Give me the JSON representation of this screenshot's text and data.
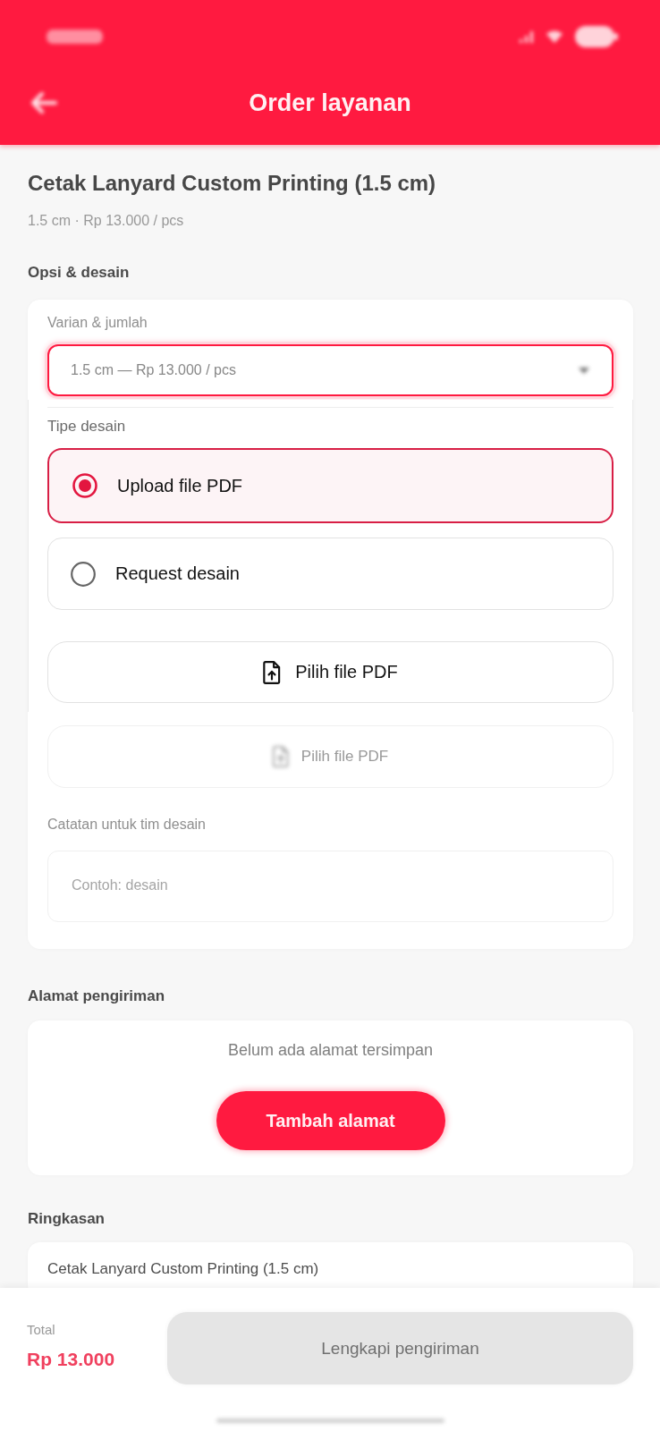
{
  "app_bar": {
    "title": "Order layanan"
  },
  "product": {
    "name": "Cetak Lanyard Custom Printing (1.5 cm)",
    "subtitle": "1.5 cm · Rp 13.000 / pcs"
  },
  "options_section": {
    "heading": "Opsi & desain",
    "variant": {
      "label": "Varian & jumlah",
      "value": "1.5 cm — Rp 13.000 / pcs"
    },
    "file_button": "Pilih file PDF",
    "notes": {
      "label": "Catatan untuk tim desain",
      "placeholder": "Contoh: desain"
    }
  },
  "design_type_panel": {
    "label": "Tipe desain",
    "options": [
      {
        "label": "Upload file PDF",
        "selected": true
      },
      {
        "label": "Request desain",
        "selected": false
      }
    ],
    "file_button": "Pilih file PDF"
  },
  "shipping": {
    "heading": "Alamat pengiriman",
    "empty_text": "Belum ada alamat tersimpan",
    "add_button": "Tambah alamat"
  },
  "summary": {
    "heading": "Ringkasan",
    "items": [
      "Cetak Lanyard Custom Printing (1.5 cm)"
    ]
  },
  "footer": {
    "total_label": "Total",
    "total": "Rp 13.000",
    "submit_button": {
      "label": "Lengkapi pengiriman",
      "disabled": true
    }
  }
}
